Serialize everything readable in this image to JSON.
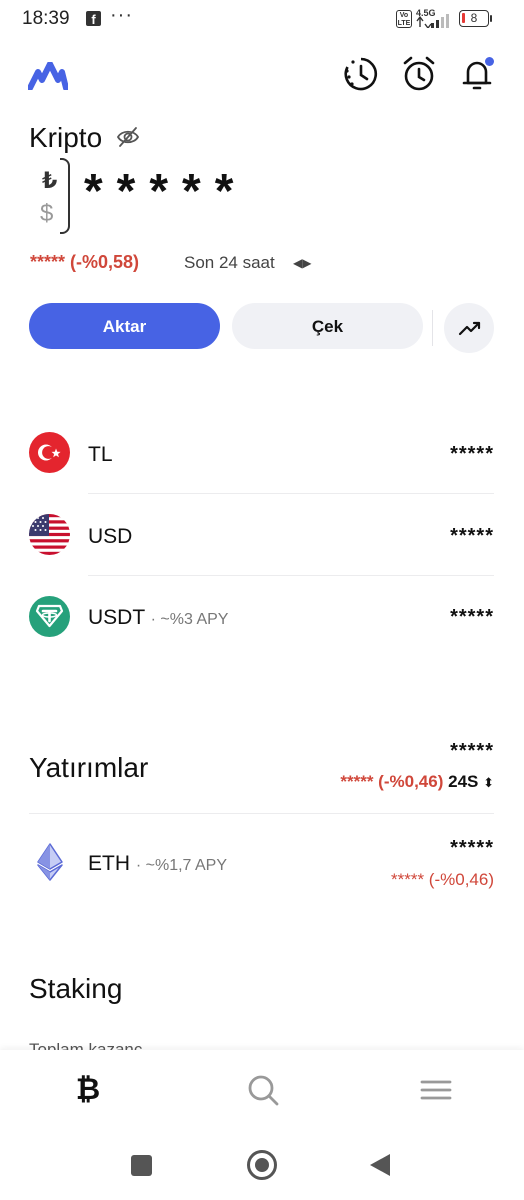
{
  "status_bar": {
    "time": "18:39",
    "fb_glyph": "f",
    "more": "···",
    "volte": "Vo LTE",
    "network": "4.5G",
    "battery": "8"
  },
  "header": {
    "title": "Kripto",
    "icons": [
      "logo-icon",
      "history-icon",
      "alarm-icon",
      "bell-icon"
    ],
    "accent_color": "#4763e4"
  },
  "balance": {
    "currency_tl": "₺",
    "currency_usd": "$",
    "masked_value": "*****",
    "change_text": "***** (-%0,58)",
    "period_label": "Son 24 saat"
  },
  "actions": {
    "transfer_label": "Aktar",
    "withdraw_label": "Çek"
  },
  "assets": [
    {
      "name": "TL",
      "sub": "",
      "value": "*****"
    },
    {
      "name": "USD",
      "sub": "",
      "value": "*****"
    },
    {
      "name": "USDT",
      "sub": "· ~%3 APY",
      "value": "*****"
    }
  ],
  "investments": {
    "title": "Yatırımlar",
    "total_value": "*****",
    "change_text": "***** (-%0,46)",
    "period": "24S",
    "items": [
      {
        "name": "ETH",
        "sub": "· ~%1,7 APY",
        "value": "*****",
        "change": "***** (-%0,46)"
      }
    ]
  },
  "staking": {
    "title": "Staking",
    "clipped_text": "Toplam kazanç"
  },
  "bottom_nav": [
    "bitcoin-icon",
    "search-icon",
    "menu-icon"
  ],
  "system_nav": [
    "recents-icon",
    "home-icon",
    "back-icon"
  ]
}
